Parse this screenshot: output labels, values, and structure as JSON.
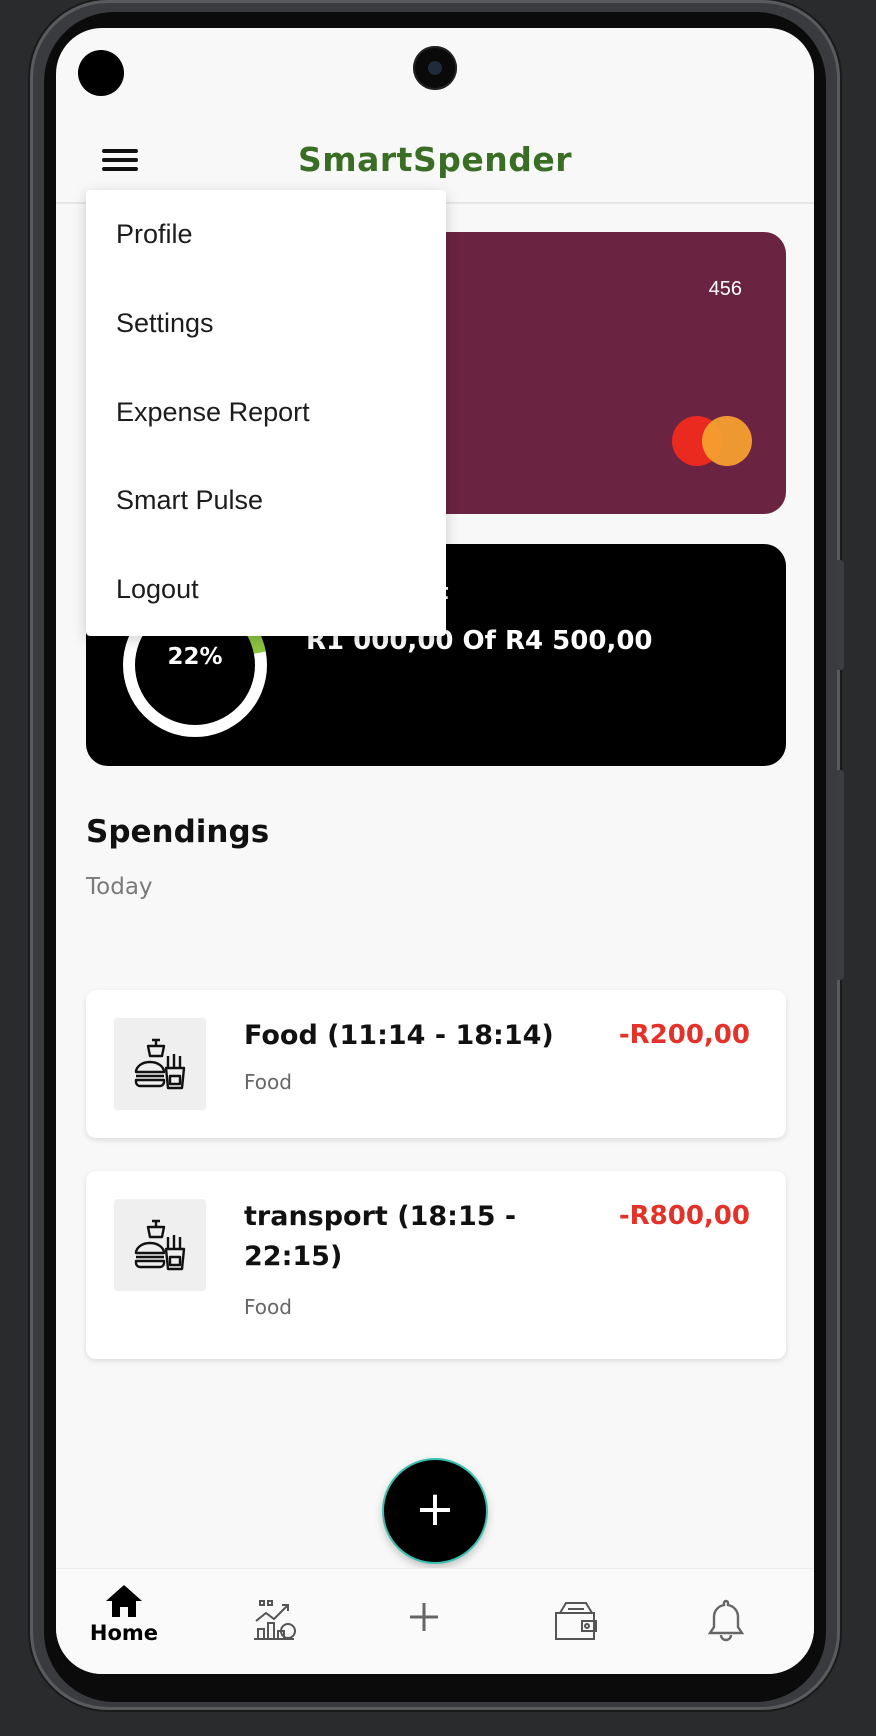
{
  "app": {
    "title": "SmartSpender"
  },
  "menu": {
    "items": [
      {
        "label": "Profile"
      },
      {
        "label": "Settings"
      },
      {
        "label": "Expense Report"
      },
      {
        "label": "Smart Pulse"
      },
      {
        "label": "Logout"
      }
    ]
  },
  "card": {
    "number_suffix": "456",
    "brand_icon": "mastercard-logo-icon",
    "color": "#6a2341"
  },
  "budget": {
    "label_fragment": "t",
    "percent_text": "22%",
    "percent": 22,
    "amount_text": "R1 000,00 Of R4 500,00",
    "ring_color": "#ffffff",
    "progress_color": "#8dc63f"
  },
  "spendings": {
    "title": "Spendings",
    "subtitle": "Today",
    "items": [
      {
        "title": "Food (11:14 - 18:14)",
        "category": "Food",
        "amount": "-R200,00",
        "icon": "food-icon"
      },
      {
        "title": "transport (18:15 - 22:15)",
        "category": "Food",
        "amount": "-R800,00",
        "icon": "food-icon"
      }
    ]
  },
  "fab": {
    "label": "+"
  },
  "bottom_nav": {
    "items": [
      {
        "label": "Home",
        "icon": "home-icon",
        "active": true
      },
      {
        "label": "",
        "icon": "analytics-icon",
        "active": false
      },
      {
        "label": "",
        "icon": "add-icon",
        "active": false
      },
      {
        "label": "",
        "icon": "wallet-icon",
        "active": false
      },
      {
        "label": "",
        "icon": "bell-icon",
        "active": false
      }
    ]
  },
  "colors": {
    "accent": "#3b6e25",
    "negative": "#e53228"
  }
}
